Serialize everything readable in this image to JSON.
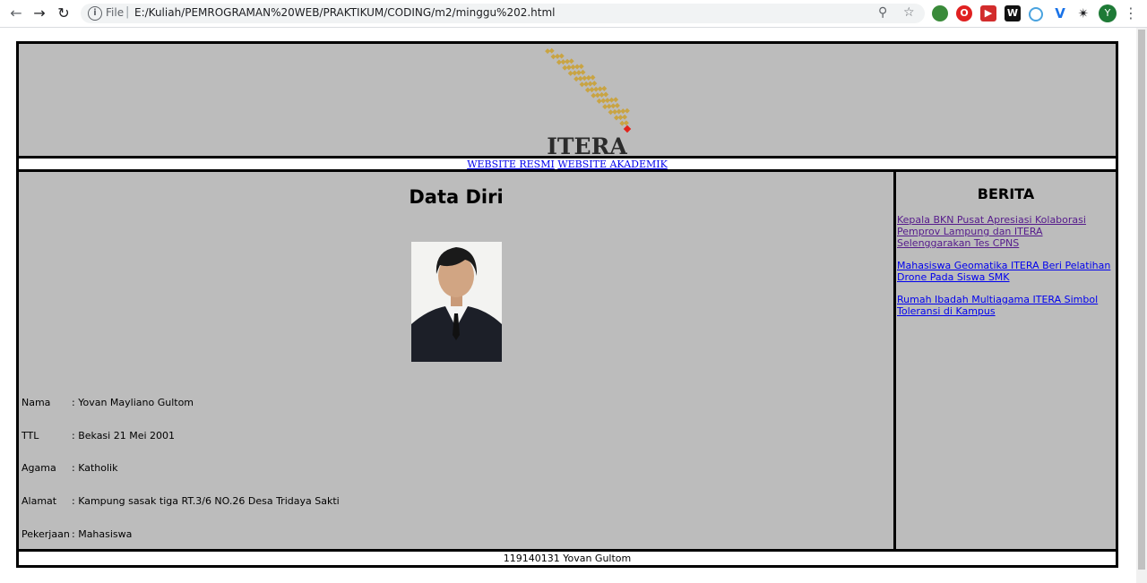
{
  "browser": {
    "back_icon": "arrow-left-icon",
    "forward_icon": "arrow-right-icon",
    "reload_icon": "reload-icon",
    "info_icon": "info-icon",
    "scheme_label": "File",
    "url": "E:/Kuliah/PEMROGRAMAN%20WEB/PRAKTIKUM/CODING/m2/minggu%202.html",
    "zoom_icon": "zoom-icon",
    "star_icon": "star-icon",
    "profile_initial": "Y",
    "menu_icon": "kebab-menu-icon"
  },
  "header": {
    "logo_text": "ITERA"
  },
  "nav": {
    "links": [
      "WEBSITE RESMI",
      "WEBSITE AKADEMIK"
    ]
  },
  "main": {
    "title": "Data Diri",
    "info": [
      {
        "label": "Nama",
        "value": ": Yovan Mayliano Gultom"
      },
      {
        "label": "TTL",
        "value": ": Bekasi 21 Mei 2001"
      },
      {
        "label": "Agama",
        "value": ": Katholik"
      },
      {
        "label": "Alamat",
        "value": ": Kampung sasak tiga RT.3/6 NO.26 Desa Tridaya Sakti"
      },
      {
        "label": "Pekerjaan",
        "value": ": Mahasiswa"
      }
    ]
  },
  "side": {
    "title": "BERITA",
    "news": [
      {
        "text": "Kepala BKN Pusat Apresiasi Kolaborasi Pemprov Lampung dan ITERA Selenggarakan Tes CPNS",
        "visited": true
      },
      {
        "text": "Mahasiswa Geomatika ITERA Beri Pelatihan Drone Pada Siswa SMK",
        "visited": false
      },
      {
        "text": "Rumah Ibadah Multiagama ITERA Simbol Toleransi di Kampus",
        "visited": false
      }
    ]
  },
  "footer": {
    "text": "119140131 Yovan Gultom"
  },
  "colors": {
    "page_bg": "#bcbcbc",
    "border": "#000000",
    "link": "#0000ee",
    "visited": "#551a8b",
    "logo_gold": "#c9a443",
    "logo_red": "#e2231a"
  }
}
